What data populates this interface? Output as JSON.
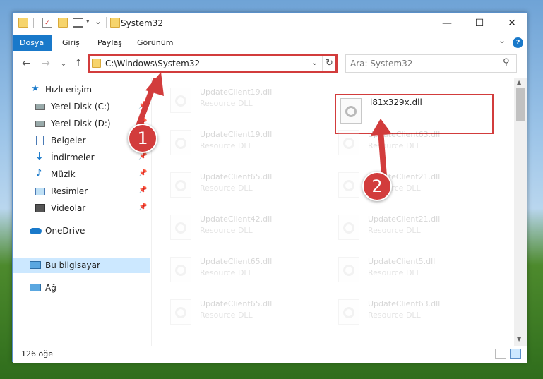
{
  "window": {
    "title": "System32",
    "controls": {
      "minimize": "—",
      "maximize": "☐",
      "close": "✕"
    }
  },
  "ribbon": {
    "tabs": [
      "Dosya",
      "Giriş",
      "Paylaş",
      "Görünüm"
    ],
    "active_tab": "Dosya",
    "help": "?"
  },
  "navigation": {
    "back_icon": "←",
    "forward_icon": "→",
    "recent_icon": "⌄",
    "up_icon": "↑",
    "address_path": "C:\\Windows\\System32",
    "refresh_icon": "↻",
    "search_placeholder": "Ara: System32"
  },
  "sidebar": {
    "items": [
      {
        "label": "Hızlı erişim",
        "icon": "star-icon"
      },
      {
        "label": "Yerel Disk (C:)",
        "icon": "drive-icon"
      },
      {
        "label": "Yerel Disk (D:)",
        "icon": "drive-icon"
      },
      {
        "label": "Belgeler",
        "icon": "documents-icon"
      },
      {
        "label": "İndirmeler",
        "icon": "download-icon"
      },
      {
        "label": "Müzik",
        "icon": "music-icon"
      },
      {
        "label": "Resimler",
        "icon": "pictures-icon"
      },
      {
        "label": "Videolar",
        "icon": "video-icon"
      },
      {
        "label": "OneDrive",
        "icon": "cloud-icon"
      },
      {
        "label": "Bu bilgisayar",
        "icon": "computer-icon"
      },
      {
        "label": "Ağ",
        "icon": "network-icon"
      }
    ],
    "selected": "Bu bilgisayar"
  },
  "files": {
    "left_column": [
      {
        "name": "UpdateClient19.dll",
        "type": "Resource DLL"
      },
      {
        "name": "UpdateClient19.dll",
        "type": "Resource DLL"
      },
      {
        "name": "UpdateClient65.dll",
        "type": "Resource DLL"
      },
      {
        "name": "UpdateClient42.dll",
        "type": "Resource DLL"
      },
      {
        "name": "UpdateClient65.dll",
        "type": "Resource DLL"
      },
      {
        "name": "UpdateClient65.dll",
        "type": "Resource DLL"
      }
    ],
    "right_column": [
      {
        "name": "i81x329x.dll",
        "type": ""
      },
      {
        "name": "UpdateClient63.dll",
        "type": "Resource DLL"
      },
      {
        "name": "UpdateClient21.dll",
        "type": "Resource DLL"
      },
      {
        "name": "UpdateClient21.dll",
        "type": "Resource DLL"
      },
      {
        "name": "UpdateClient5.dll",
        "type": "Resource DLL"
      },
      {
        "name": "UpdateClient63.dll",
        "type": "Resource DLL"
      }
    ]
  },
  "status": {
    "item_count": "126 öğe"
  },
  "annotations": {
    "badge_1": "1",
    "badge_2": "2",
    "color": "#d23c3c"
  }
}
